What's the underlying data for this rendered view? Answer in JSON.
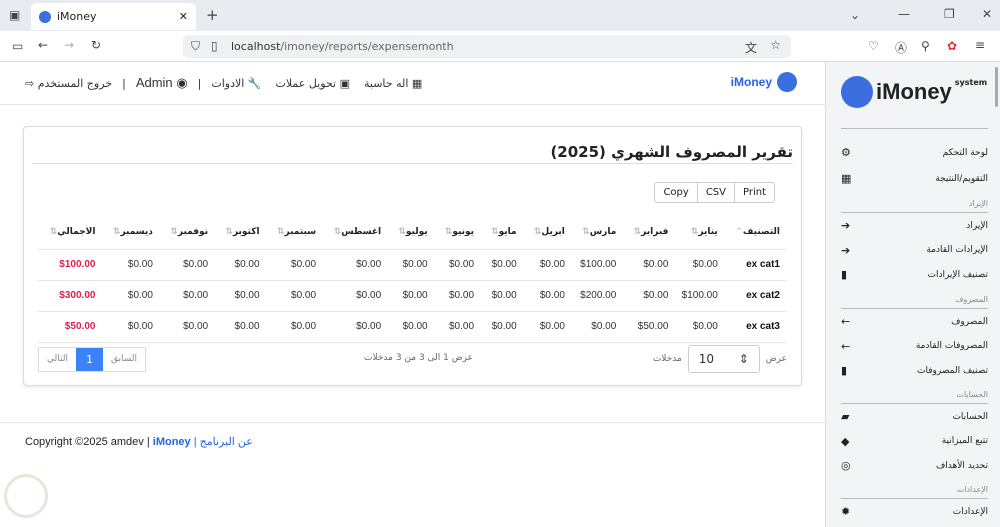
{
  "browser": {
    "tab_title": "iMoney",
    "url_host": "localhost",
    "url_path": "/imoney/reports/expensemonth"
  },
  "topnav": {
    "brand": "iMoney",
    "calculator": "اله حاسبة",
    "currency": "تحويل عملات",
    "tools": "الادوات",
    "user": "Admin",
    "logout": "خروج المستخدم",
    "sep": "|"
  },
  "report": {
    "title": "تقرير المصروف الشهري (2025)",
    "buttons": [
      "Copy",
      "CSV",
      "Print"
    ],
    "headers": [
      "التصنيف",
      "يناير",
      "فبراير",
      "مارس",
      "ابريل",
      "مايو",
      "يونيو",
      "يوليو",
      "اغسطس",
      "سبتمبر",
      "اكتوبر",
      "نوفمبر",
      "ديسمبر",
      "الاجمالي"
    ],
    "rows": [
      [
        "ex cat1",
        "$0.00",
        "$0.00",
        "$100.00",
        "$0.00",
        "$0.00",
        "$0.00",
        "$0.00",
        "$0.00",
        "$0.00",
        "$0.00",
        "$0.00",
        "$0.00",
        "$100.00"
      ],
      [
        "ex cat2",
        "$100.00",
        "$0.00",
        "$200.00",
        "$0.00",
        "$0.00",
        "$0.00",
        "$0.00",
        "$0.00",
        "$0.00",
        "$0.00",
        "$0.00",
        "$0.00",
        "$300.00"
      ],
      [
        "ex cat3",
        "$0.00",
        "$50.00",
        "$0.00",
        "$0.00",
        "$0.00",
        "$0.00",
        "$0.00",
        "$0.00",
        "$0.00",
        "$0.00",
        "$0.00",
        "$0.00",
        "$50.00"
      ]
    ],
    "show_label": "عرض",
    "entries_label": "مدخلات",
    "page_length": "10",
    "info": "عرض 1 الى 3 من 3 مدخلات",
    "prev": "السابق",
    "page": "1",
    "next": "التالي"
  },
  "footer": {
    "copyright": "Copyright ©2025 amdev |",
    "brand": "iMoney",
    "about": "| عن البرنامج"
  },
  "sidebar": {
    "logo": "iMoney",
    "logo_sup": "system",
    "items": [
      {
        "label": "لوحة التحكم",
        "icon": "⚙"
      },
      {
        "label": "التقويم/النتيجة",
        "icon": "▦"
      }
    ],
    "sections": [
      {
        "title": "الإيراد",
        "items": [
          {
            "label": "الإيراد",
            "icon": "➔"
          },
          {
            "label": "الإيرادات القادمة",
            "icon": "➔"
          },
          {
            "label": "تصنيف الإيرادات",
            "icon": "▮"
          }
        ]
      },
      {
        "title": "المصروف",
        "items": [
          {
            "label": "المصروف",
            "icon": "←"
          },
          {
            "label": "المصروفات القادمة",
            "icon": "←"
          },
          {
            "label": "تصنيف المصروفات",
            "icon": "▮"
          }
        ]
      },
      {
        "title": "الحسابات",
        "items": [
          {
            "label": "الحسابات",
            "icon": "▰"
          },
          {
            "label": "تتبع الميزانية",
            "icon": "◆"
          },
          {
            "label": "تحديد الأهداف",
            "icon": "◎"
          }
        ]
      },
      {
        "title": "الإعدادات",
        "items": [
          {
            "label": "الإعدادات",
            "icon": "✹"
          }
        ]
      }
    ]
  }
}
